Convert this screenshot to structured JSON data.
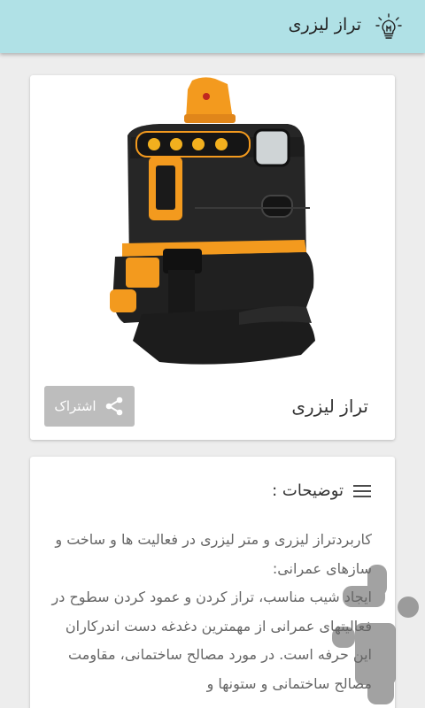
{
  "app": {
    "title": "تراز لیزری",
    "icon": "lightbulb-icon",
    "colors": {
      "appbar": "#b0e1e6",
      "background": "#ededed",
      "share_button": "#bdbdbd"
    }
  },
  "product": {
    "image": "laser-level-device-image",
    "title": "تراز لیزری",
    "share_label": "اشتراک",
    "share_icon": "share-icon"
  },
  "description": {
    "title": "توضیحات :",
    "icon": "menu-icon",
    "body": "کاربردتراز لیزری و متر لیزری در فعالیت ها و ساخت و سازهای عمرانی:\nایجاد شیب مناسب، تراز کردن و عمود کردن سطوح در فعالیتهای عمرانی از مهمترین دغدغه دست اندرکاران این حرفه است. در مورد مصالح ساختمانی، مقاومت مصالح ساختمانی و ستونها و"
  },
  "watermark": {
    "icon": "app-logo-watermark"
  }
}
